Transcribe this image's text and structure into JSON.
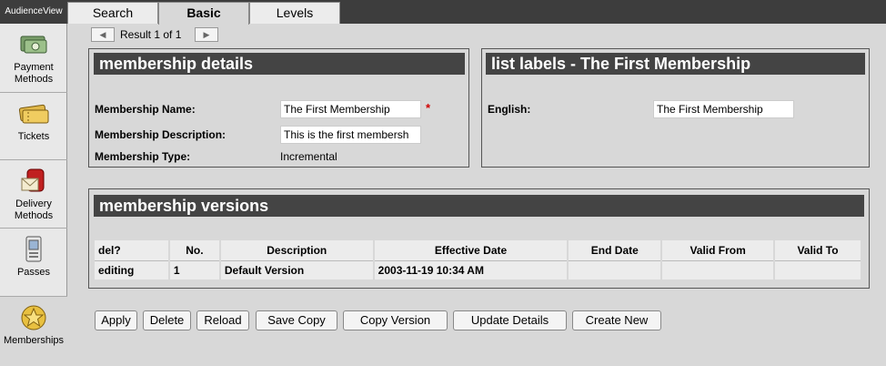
{
  "app": {
    "title": "AudienceView"
  },
  "tabs": [
    {
      "label": "Search"
    },
    {
      "label": "Basic"
    },
    {
      "label": "Levels"
    }
  ],
  "sidebar": {
    "items": [
      {
        "label": "Payment Methods",
        "icon": "payment-methods-icon"
      },
      {
        "label": "Tickets",
        "icon": "tickets-icon"
      },
      {
        "label": "Delivery Methods",
        "icon": "delivery-methods-icon"
      },
      {
        "label": "Passes",
        "icon": "passes-icon"
      },
      {
        "label": "Memberships",
        "icon": "memberships-icon"
      }
    ]
  },
  "result_nav": {
    "prev_glyph": "◀",
    "next_glyph": "▶",
    "text": "Result 1 of 1"
  },
  "membership_details": {
    "title": "membership details",
    "name_label": "Membership Name:",
    "name_value": "The First Membership",
    "required_mark": "*",
    "description_label": "Membership Description:",
    "description_value": "This is the first membersh",
    "type_label": "Membership Type:",
    "type_value": "Incremental"
  },
  "list_labels": {
    "title": "list labels - The First Membership",
    "english_label": "English:",
    "english_value": "The First Membership"
  },
  "membership_versions": {
    "title": "membership versions",
    "columns": [
      "del?",
      "No.",
      "Description",
      "Effective Date",
      "End Date",
      "Valid From",
      "Valid To"
    ],
    "rows": [
      [
        "editing",
        "1",
        "Default Version",
        "2003-11-19 10:34 AM",
        "",
        "",
        ""
      ]
    ]
  },
  "buttons": {
    "apply": "Apply",
    "delete": "Delete",
    "reload": "Reload",
    "save_copy": "Save Copy",
    "copy_version": "Copy Version",
    "update_details": "Update Details",
    "create_new": "Create New"
  },
  "colors": {
    "header_bar": "#3d3d3d",
    "panel_header": "#444444",
    "required": "#d00000",
    "background": "#d8d8d8"
  }
}
